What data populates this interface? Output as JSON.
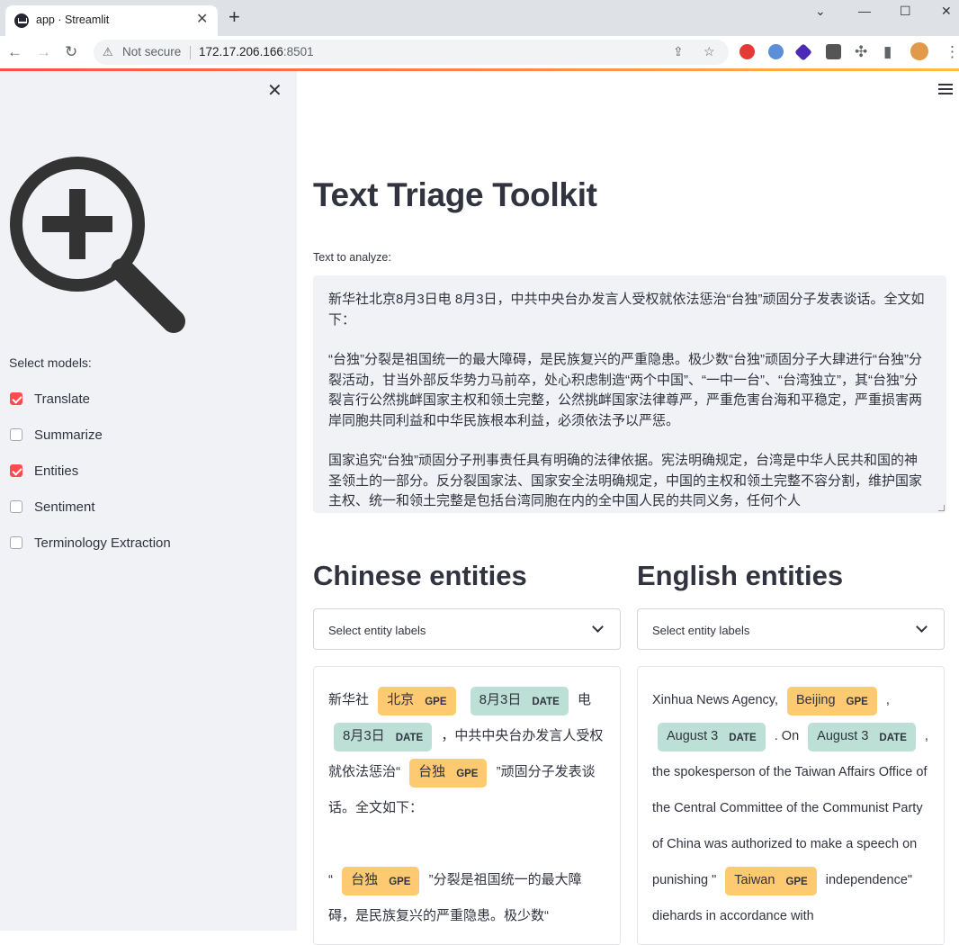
{
  "browser": {
    "tab_title": "app · Streamlit",
    "tab_close": "✕",
    "new_tab": "+",
    "security_label": "Not secure",
    "url_host": "172.17.206.166",
    "url_port": ":8501",
    "window_controls": [
      "⌄",
      "—",
      "☐",
      "✕"
    ]
  },
  "sidebar": {
    "close_icon": "✕",
    "select_label": "Select models:",
    "models": [
      {
        "label": "Translate",
        "checked": true
      },
      {
        "label": "Summarize",
        "checked": false
      },
      {
        "label": "Entities",
        "checked": true
      },
      {
        "label": "Sentiment",
        "checked": false
      },
      {
        "label": "Terminology Extraction",
        "checked": false
      }
    ]
  },
  "main": {
    "title": "Text Triage Toolkit",
    "text_label": "Text to analyze:",
    "text_paragraphs": [
      "新华社北京8月3日电 8月3日，中共中央台办发言人受权就依法惩治“台独”顽固分子发表谈话。全文如下：",
      "“台独”分裂是祖国统一的最大障碍，是民族复兴的严重隐患。极少数“台独”顽固分子大肆进行“台独”分裂活动，甘当外部反华势力马前卒，处心积虑制造“两个中国”、“一中一台”、“台湾独立”，其“台独”分裂言行公然挑衅国家主权和领土完整，公然挑衅国家法律尊严，严重危害台海和平稳定，严重损害两岸同胞共同利益和中华民族根本利益，必须依法予以严惩。",
      "国家追究“台独”顽固分子刑事责任具有明确的法律依据。宪法明确规定，台湾是中华人民共和国的神圣领土的一部分。反分裂国家法、国家安全法明确规定，中国的主权和领土完整不容分割，维护国家主权、统一和领土完整是包括台湾同胞在内的全中国人民的共同义务，任何个人"
    ],
    "zh_heading": "Chinese entities",
    "en_heading": "English entities",
    "select_placeholder": "Select entity labels",
    "zh_entities": {
      "t1": "新华社",
      "e1": "北京",
      "l1": "GPE",
      "e2": "8月3日",
      "l2": "DATE",
      "t2": "电",
      "e3": "8月3日",
      "l3": "DATE",
      "t3": "，中共中央台办发言人受权就依法惩治“",
      "e4": "台独",
      "l4": "GPE",
      "t4": "”顽固分子发表谈话。全文如下：",
      "t5": "“",
      "e5": "台独",
      "l5": "GPE",
      "t6": "”分裂是祖国统一的最大障碍，是民族复兴的严重隐患。极少数“"
    },
    "en_entities": {
      "t1": "Xinhua News Agency,",
      "e1": "Beijing",
      "l1": "GPE",
      "t2": ",",
      "e2": "August 3",
      "l2": "DATE",
      "t3": ". On",
      "e3": "August 3",
      "l3": "DATE",
      "t4": ",",
      "t5": "the spokesperson of the Taiwan Affairs Office of the Central Committee of the Communist Party of China was authorized to make a speech on punishing \"",
      "e4": "Taiwan",
      "l4": "GPE",
      "t6": "independence\" diehards in accordance with"
    }
  },
  "colors": {
    "accent": "#ff4b4b",
    "gpe": "#fdc971",
    "date": "#bde0d6",
    "sidebar_bg": "#f0f2f6"
  }
}
